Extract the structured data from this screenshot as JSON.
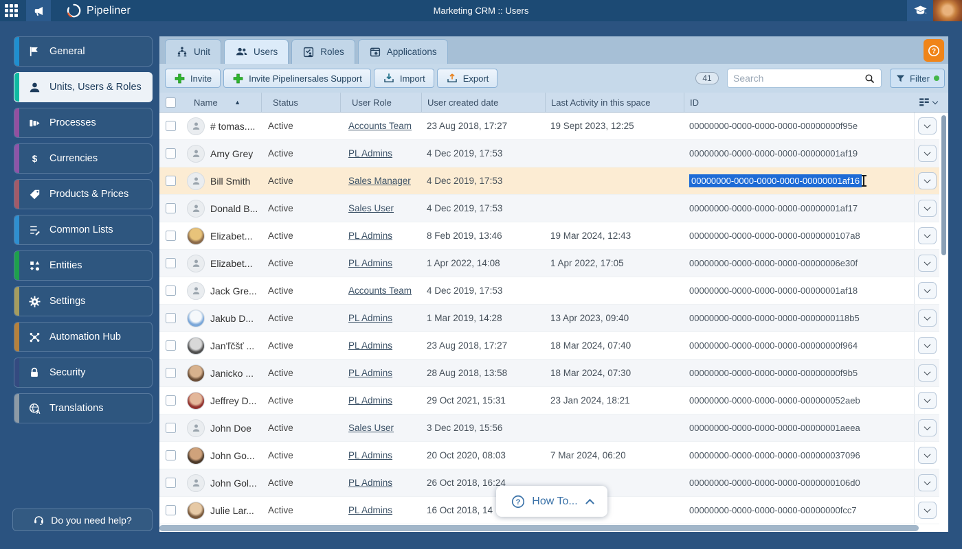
{
  "colors": {
    "topbar": "#1c4a74",
    "page_background": "#2b5380",
    "row_highlight": "#fcecd3",
    "selection_blue": "#1e6bd6",
    "help_orange": "#f08418",
    "filter_green_dot": "#43b649"
  },
  "topbar": {
    "brand": "Pipeliner",
    "title": "Marketing CRM :: Users"
  },
  "sidebar": {
    "items": [
      {
        "label": "General",
        "icon": "flag",
        "accent": "#1f8fd0",
        "active": false
      },
      {
        "label": "Units, Users & Roles",
        "icon": "person",
        "accent": "#0fb9a1",
        "active": true
      },
      {
        "label": "Processes",
        "icon": "funnel",
        "accent": "#9350a0",
        "active": false
      },
      {
        "label": "Currencies",
        "icon": "dollar",
        "accent": "#8d55a8",
        "active": false
      },
      {
        "label": "Products & Prices",
        "icon": "tag",
        "accent": "#a25b69",
        "active": false
      },
      {
        "label": "Common Lists",
        "icon": "list",
        "accent": "#2f8fd0",
        "active": false
      },
      {
        "label": "Entities",
        "icon": "shapes",
        "accent": "#1ea04c",
        "active": false
      },
      {
        "label": "Settings",
        "icon": "gear",
        "accent": "#a49c60",
        "active": false
      },
      {
        "label": "Automation Hub",
        "icon": "network",
        "accent": "#b5813d",
        "active": false
      },
      {
        "label": "Security",
        "icon": "lock",
        "accent": "#344a80",
        "active": false
      },
      {
        "label": "Translations",
        "icon": "globe",
        "accent": "#8d9aa6",
        "active": false
      }
    ],
    "help_button": "Do you need help?"
  },
  "tabs": [
    {
      "label": "Unit",
      "icon": "org",
      "active": false
    },
    {
      "label": "Users",
      "icon": "users",
      "active": true
    },
    {
      "label": "Roles",
      "icon": "roles",
      "active": false
    },
    {
      "label": "Applications",
      "icon": "apps",
      "active": false
    }
  ],
  "toolbar": {
    "buttons": [
      {
        "label": "Invite",
        "icon": "plus"
      },
      {
        "label": "Invite Pipelinersales Support",
        "icon": "plus"
      },
      {
        "label": "Import",
        "icon": "import"
      },
      {
        "label": "Export",
        "icon": "export"
      }
    ],
    "record_count": "41",
    "search_placeholder": "Search",
    "filter_label": "Filter"
  },
  "table": {
    "headers": [
      "Name",
      "Status",
      "User Role",
      "User created date",
      "Last Activity in this space",
      "ID"
    ],
    "rows": [
      {
        "name": "# tomas....",
        "status": "Active",
        "role": "Accounts Team",
        "created": "23 Aug 2018, 17:27",
        "activity": "19 Sept 2023, 12:25",
        "id": "00000000-0000-0000-0000-00000000f95e",
        "avatar": "generic",
        "selected": false
      },
      {
        "name": "Amy Grey",
        "status": "Active",
        "role": "PL Admins",
        "created": "4 Dec 2019, 17:53",
        "activity": "",
        "id": "00000000-0000-0000-0000-00000001af19",
        "avatar": "generic",
        "selected": false
      },
      {
        "name": "Bill Smith",
        "status": "Active",
        "role": "Sales Manager",
        "created": "4 Dec 2019, 17:53",
        "activity": "",
        "id": "00000000-0000-0000-0000-00000001af16",
        "avatar": "generic",
        "selected": true
      },
      {
        "name": "Donald B...",
        "status": "Active",
        "role": "Sales User",
        "created": "4 Dec 2019, 17:53",
        "activity": "",
        "id": "00000000-0000-0000-0000-00000001af17",
        "avatar": "generic",
        "selected": false
      },
      {
        "name": "Elizabet...",
        "status": "Active",
        "role": "PL Admins",
        "created": "8 Feb 2019, 13:46",
        "activity": "19 Mar 2024, 12:43",
        "id": "00000000-0000-0000-0000-0000000107a8",
        "avatar": "photo",
        "colors": [
          "#e8c37a",
          "#8a6a4a"
        ],
        "selected": false
      },
      {
        "name": "Elizabet...",
        "status": "Active",
        "role": "PL Admins",
        "created": "1 Apr 2022, 14:08",
        "activity": "1 Apr 2022, 17:05",
        "id": "00000000-0000-0000-0000-00000006e30f",
        "avatar": "generic",
        "selected": false
      },
      {
        "name": "Jack Gre...",
        "status": "Active",
        "role": "Accounts Team",
        "created": "4 Dec 2019, 17:53",
        "activity": "",
        "id": "00000000-0000-0000-0000-00000001af18",
        "avatar": "generic",
        "selected": false
      },
      {
        "name": "Jakub D...",
        "status": "Active",
        "role": "PL Admins",
        "created": "1 Mar 2019, 14:28",
        "activity": "13 Apr 2023, 09:40",
        "id": "00000000-0000-0000-0000-0000000118b5",
        "avatar": "photo",
        "colors": [
          "#f5f8fb",
          "#7aa7d9"
        ],
        "selected": false
      },
      {
        "name": "Jan'ľčšť ...",
        "status": "Active",
        "role": "PL Admins",
        "created": "23 Aug 2018, 17:27",
        "activity": "18 Mar 2024, 07:40",
        "id": "00000000-0000-0000-0000-00000000f964",
        "avatar": "photo",
        "colors": [
          "#d8d8d8",
          "#4f4f4f"
        ],
        "selected": false
      },
      {
        "name": "Janicko ...",
        "status": "Active",
        "role": "PL Admins",
        "created": "28 Aug 2018, 13:58",
        "activity": "18 Mar 2024, 07:30",
        "id": "00000000-0000-0000-0000-00000000f9b5",
        "avatar": "photo",
        "colors": [
          "#d8b28e",
          "#6b4e37"
        ],
        "selected": false
      },
      {
        "name": "Jeffrey D...",
        "status": "Active",
        "role": "PL Admins",
        "created": "29 Oct 2021, 15:31",
        "activity": "23 Jan 2024, 18:21",
        "id": "00000000-0000-0000-0000-000000052aeb",
        "avatar": "photo",
        "colors": [
          "#e3b79a",
          "#93322e"
        ],
        "selected": false
      },
      {
        "name": "John Doe",
        "status": "Active",
        "role": "Sales User",
        "created": "3 Dec 2019, 15:56",
        "activity": "",
        "id": "00000000-0000-0000-0000-00000001aeea",
        "avatar": "generic",
        "selected": false
      },
      {
        "name": "John Go...",
        "status": "Active",
        "role": "PL Admins",
        "created": "20 Oct 2020, 08:03",
        "activity": "7 Mar 2024, 06:20",
        "id": "00000000-0000-0000-0000-000000037096",
        "avatar": "photo",
        "colors": [
          "#cfa27b",
          "#4c3a2a"
        ],
        "selected": false
      },
      {
        "name": "John Gol...",
        "status": "Active",
        "role": "PL Admins",
        "created": "26 Oct 2018, 16:24",
        "activity": "",
        "id": "00000000-0000-0000-0000-0000000106d0",
        "avatar": "generic",
        "selected": false
      },
      {
        "name": "Julie Lar...",
        "status": "Active",
        "role": "PL Admins",
        "created": "16 Oct 2018, 14",
        "activity": "",
        "id": "00000000-0000-0000-0000-00000000fcc7",
        "avatar": "photo",
        "colors": [
          "#e6c9a5",
          "#7a5a3c"
        ],
        "selected": false
      }
    ]
  },
  "howto": {
    "label": "How To..."
  }
}
